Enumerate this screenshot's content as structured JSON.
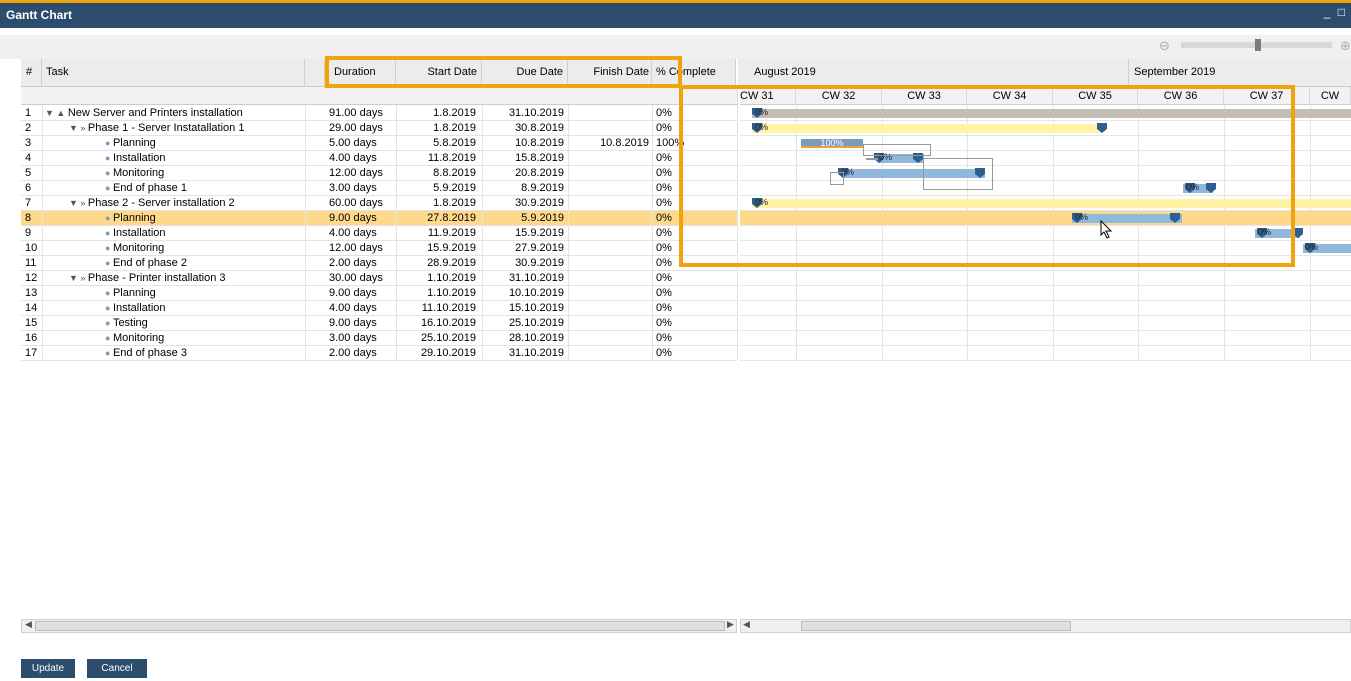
{
  "window": {
    "title": "Gantt Chart",
    "controls": "_ □"
  },
  "zoom": {
    "out_icon": "⊖",
    "in_icon": "⊕",
    "level": 0.5
  },
  "columns": {
    "num": "#",
    "task": "Task",
    "duration": "Duration",
    "start": "Start Date",
    "due": "Due Date",
    "finish": "Finish Date",
    "pct": "% Complete"
  },
  "months": [
    "August 2019",
    "September 2019"
  ],
  "weeks": [
    "CW 31",
    "CW 32",
    "CW 33",
    "CW 34",
    "CW 35",
    "CW 36",
    "CW 37",
    "CW"
  ],
  "rows": [
    {
      "n": "1",
      "task": "New Server and Printers installation",
      "dur": "91.00 days",
      "start": "1.8.2019",
      "due": "31.10.2019",
      "fin": "",
      "pct": "0%"
    },
    {
      "n": "2",
      "task": "Phase 1 - Server Instatallation 1",
      "dur": "29.00 days",
      "start": "1.8.2019",
      "due": "30.8.2019",
      "fin": "",
      "pct": "0%"
    },
    {
      "n": "3",
      "task": "Planning",
      "dur": "5.00 days",
      "start": "5.8.2019",
      "due": "10.8.2019",
      "fin": "10.8.2019",
      "pct": "100%"
    },
    {
      "n": "4",
      "task": "Installation",
      "dur": "4.00 days",
      "start": "11.8.2019",
      "due": "15.8.2019",
      "fin": "",
      "pct": "0%"
    },
    {
      "n": "5",
      "task": "Monitoring",
      "dur": "12.00 days",
      "start": "8.8.2019",
      "due": "20.8.2019",
      "fin": "",
      "pct": "0%"
    },
    {
      "n": "6",
      "task": "End of phase 1",
      "dur": "3.00 days",
      "start": "5.9.2019",
      "due": "8.9.2019",
      "fin": "",
      "pct": "0%"
    },
    {
      "n": "7",
      "task": "Phase 2 - Server installation 2",
      "dur": "60.00 days",
      "start": "1.8.2019",
      "due": "30.9.2019",
      "fin": "",
      "pct": "0%"
    },
    {
      "n": "8",
      "task": "Planning",
      "dur": "9.00 days",
      "start": "27.8.2019",
      "due": "5.9.2019",
      "fin": "",
      "pct": "0%"
    },
    {
      "n": "9",
      "task": "Installation",
      "dur": "4.00 days",
      "start": "11.9.2019",
      "due": "15.9.2019",
      "fin": "",
      "pct": "0%"
    },
    {
      "n": "10",
      "task": "Monitoring",
      "dur": "12.00 days",
      "start": "15.9.2019",
      "due": "27.9.2019",
      "fin": "",
      "pct": "0%"
    },
    {
      "n": "11",
      "task": "End of phase 2",
      "dur": "2.00 days",
      "start": "28.9.2019",
      "due": "30.9.2019",
      "fin": "",
      "pct": "0%"
    },
    {
      "n": "12",
      "task": "Phase - Printer installation 3",
      "dur": "30.00 days",
      "start": "1.10.2019",
      "due": "31.10.2019",
      "fin": "",
      "pct": "0%"
    },
    {
      "n": "13",
      "task": "Planning",
      "dur": "9.00 days",
      "start": "1.10.2019",
      "due": "10.10.2019",
      "fin": "",
      "pct": "0%"
    },
    {
      "n": "14",
      "task": "Installation",
      "dur": "4.00 days",
      "start": "11.10.2019",
      "due": "15.10.2019",
      "fin": "",
      "pct": "0%"
    },
    {
      "n": "15",
      "task": "Testing",
      "dur": "9.00 days",
      "start": "16.10.2019",
      "due": "25.10.2019",
      "fin": "",
      "pct": "0%"
    },
    {
      "n": "16",
      "task": "Monitoring",
      "dur": "3.00 days",
      "start": "25.10.2019",
      "due": "28.10.2019",
      "fin": "",
      "pct": "0%"
    },
    {
      "n": "17",
      "task": "End of phase 3",
      "dur": "2.00 days",
      "start": "29.10.2019",
      "due": "31.10.2019",
      "fin": "",
      "pct": "0%"
    }
  ],
  "gantt_labels": {
    "pct0": "0%",
    "pct100": "100%"
  },
  "buttons": {
    "update": "Update",
    "cancel": "Cancel"
  },
  "colors": {
    "titlebar": "#2c4d6e",
    "accent": "#f0a30a",
    "selected_row": "#ffd98a",
    "task_bar": "#8fb8dc",
    "phase_bar": "#fff3a6",
    "summary_bar": "#c4bdb3",
    "milestone": "#2f5f8f"
  }
}
